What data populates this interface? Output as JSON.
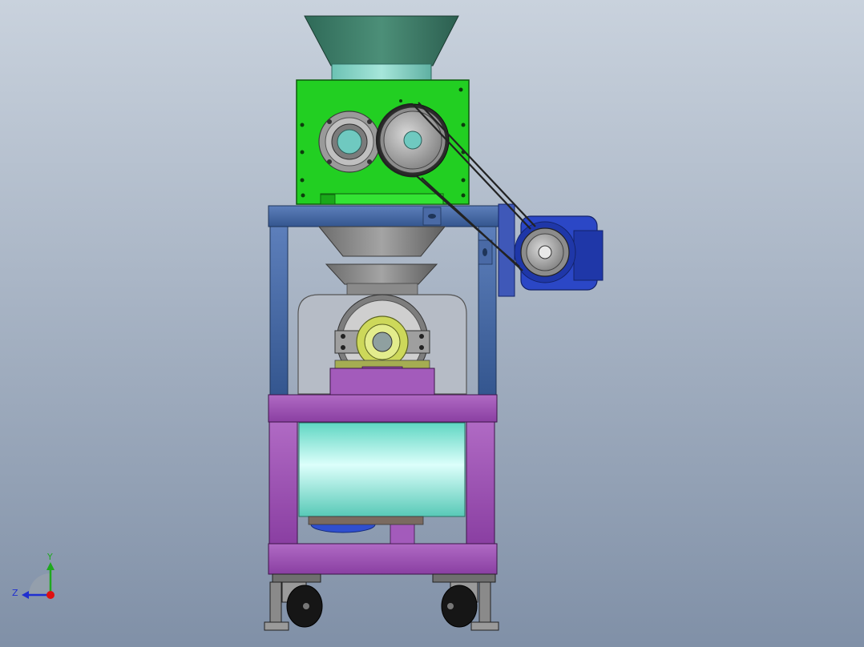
{
  "view": {
    "background_top": "#c8d1dc",
    "background_bottom": "#7e8ea5"
  },
  "colors": {
    "hopper": "#3f7f6a",
    "hopper_neck": "#7fd0c2",
    "crusher_housing": "#1fd21f",
    "upper_frame": "#3d5f99",
    "lower_frame": "#9a4fb0",
    "motor": "#2344c8",
    "tank": "#9af7ea",
    "bearing": "#c9d650",
    "chute": "#8a8a8a",
    "caster": "#1a1a1a"
  },
  "triad": {
    "y_label": "Y",
    "z_label": "Z",
    "y_color": "#1fa81f",
    "z_color": "#1f2fd0",
    "x_color": "#e01010"
  }
}
